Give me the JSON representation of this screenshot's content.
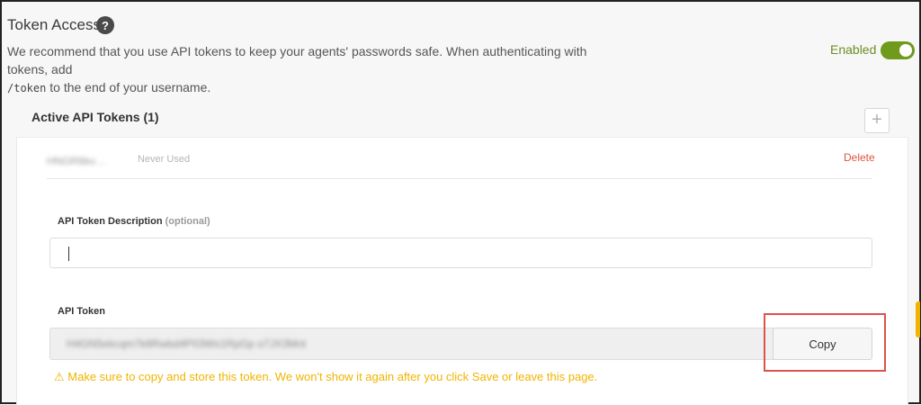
{
  "header": {
    "title": "Token Access",
    "help_icon": "?",
    "description_before": "We recommend that you use API tokens to keep your agents' passwords safe. When authenticating with tokens, add",
    "description_code": "/token",
    "description_after": " to the end of your username.",
    "enabled_label": "Enabled",
    "toggle_on": true
  },
  "tokens_section": {
    "title": "Active API Tokens (1)",
    "add_icon": "+",
    "token": {
      "name": "HNGR6kv…",
      "status": "Never Used",
      "delete_label": "Delete"
    }
  },
  "form": {
    "description_label": "API Token Description",
    "description_optional": "(optional)",
    "description_value": "",
    "token_label": "API Token",
    "token_value": "H4GN5ekcqm7k8Rwbd4P03Ws1RpGp o7JX3Mnt",
    "copy_label": "Copy",
    "warning_icon": "⚠",
    "warning_text": "Make sure to copy and store this token. We won't show it again after you click Save or leave this page."
  },
  "colors": {
    "accent": "#6f9a1c",
    "danger": "#e0533f",
    "warning": "#f0b400",
    "highlight": "#d9534f"
  }
}
